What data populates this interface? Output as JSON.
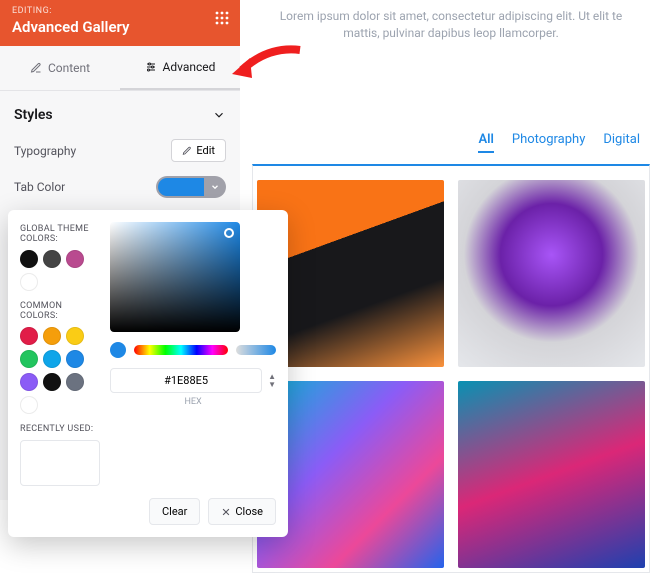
{
  "header": {
    "editing_label": "EDITING:",
    "module_title": "Advanced Gallery"
  },
  "tabs": {
    "content": "Content",
    "advanced": "Advanced"
  },
  "styles": {
    "title": "Styles",
    "typography_label": "Typography",
    "edit_btn": "Edit",
    "tab_color_label": "Tab Color",
    "swatch_hex": "#1E88E5"
  },
  "picker": {
    "global_label": "GLOBAL THEME COLORS:",
    "global_colors": [
      "#111111",
      "#444444",
      "#b94a8f",
      "#ffffff"
    ],
    "common_label": "COMMON COLORS:",
    "common_colors": [
      "#e11d48",
      "#f59e0b",
      "#facc15",
      "#22c55e",
      "#0ea5e9",
      "#1e88e5",
      "#8b5cf6",
      "#111111",
      "#6b7280",
      "#ffffff"
    ],
    "recent_label": "RECENTLY USED:",
    "hex_value": "#1E88E5",
    "hex_label": "HEX",
    "clear": "Clear",
    "close": "Close"
  },
  "preview": {
    "lorem": "Lorem ipsum dolor sit amet, consectetur adipiscing elit. Ut elit te mattis, pulvinar dapibus leop llamcorper.",
    "filters": [
      "All",
      "Photography",
      "Digital"
    ]
  }
}
